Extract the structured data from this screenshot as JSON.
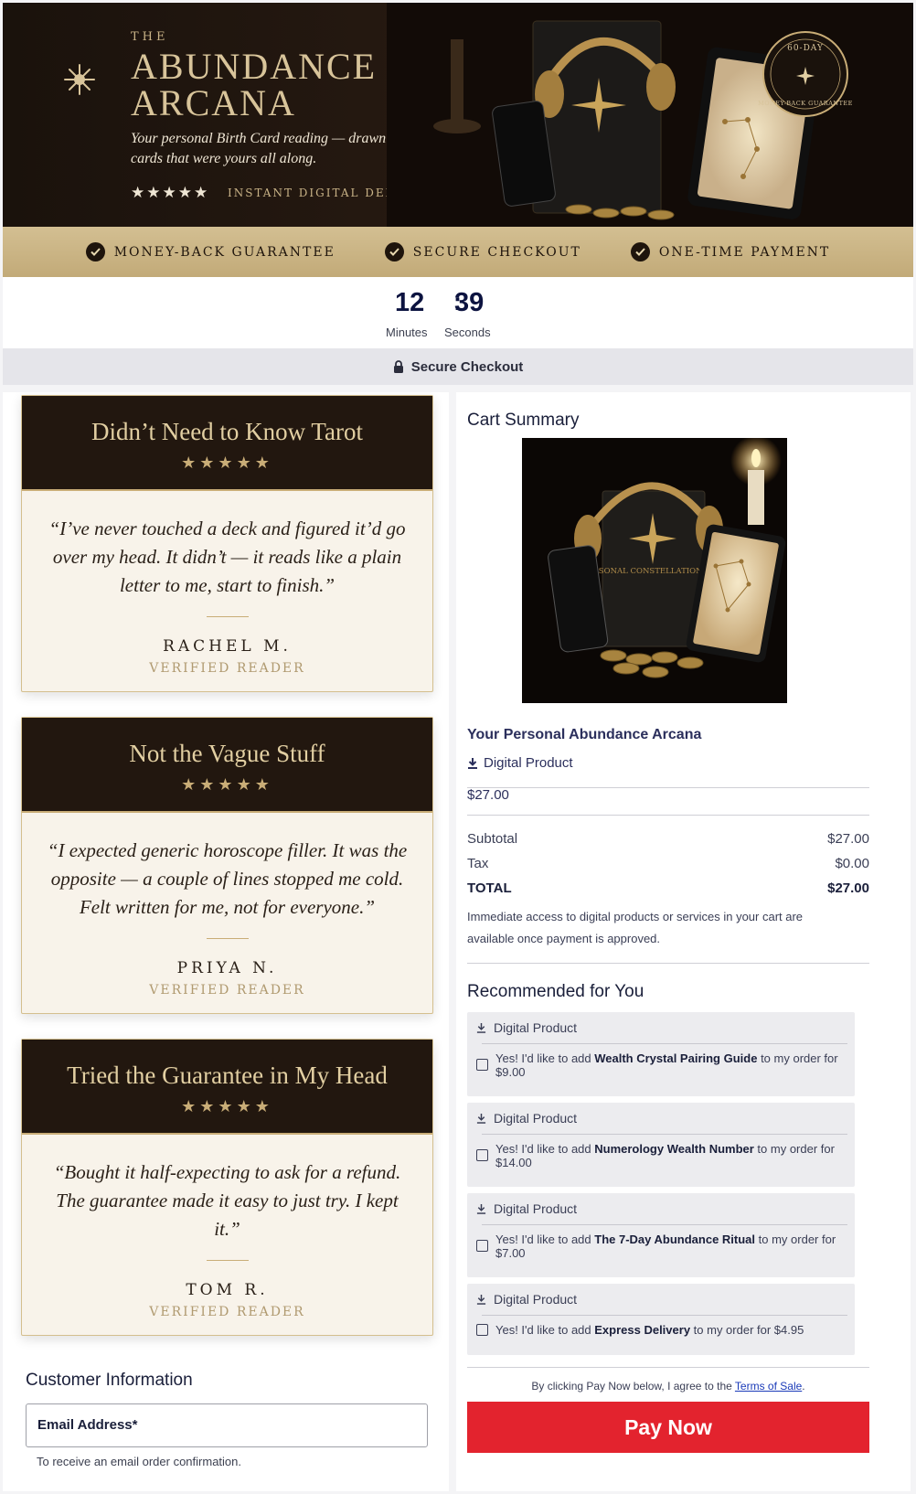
{
  "hero": {
    "the": "THE",
    "title_line1": "ABUNDANCE",
    "title_line2": "ARCANA",
    "subtitle": "Your personal Birth Card reading — drawn from the cards that were yours all along.",
    "stars": "★★★★★",
    "delivery": "INSTANT DIGITAL DELIVERY",
    "badge_top": "60-DAY",
    "badge_bottom": "MONEY-BACK GUARANTEE"
  },
  "trust_bar": {
    "items": [
      "MONEY-BACK GUARANTEE",
      "SECURE CHECKOUT",
      "ONE-TIME PAYMENT"
    ]
  },
  "timer": {
    "minutes": "12",
    "seconds": "39",
    "separator": ":",
    "minutes_label": "Minutes",
    "seconds_label": "Seconds"
  },
  "secure_checkout": "Secure Checkout",
  "testimonials": [
    {
      "title": "Didn’t Need to Know Tarot",
      "stars": "★★★★★",
      "quote": "“I’ve never touched a deck and figured it’d go over my head. It didn’t — it reads like a plain letter to me, start to finish.”",
      "author": "RACHEL M.",
      "role": "VERIFIED READER"
    },
    {
      "title": "Not the Vague Stuff",
      "stars": "★★★★★",
      "quote": "“I expected generic horoscope filler. It was the opposite — a couple of lines stopped me cold. Felt written for me, not for everyone.”",
      "author": "PRIYA N.",
      "role": "VERIFIED READER"
    },
    {
      "title": "Tried the Guarantee in My Head",
      "stars": "★★★★★",
      "quote": "“Bought it half-expecting to ask for a refund. The guarantee made it easy to just try. I kept it.”",
      "author": "TOM R.",
      "role": "VERIFIED READER"
    }
  ],
  "customer": {
    "title": "Customer Information",
    "email_label": "Email Address*",
    "email_hint": "To receive an email order confirmation."
  },
  "cart": {
    "title": "Cart Summary",
    "book_text": "YOUR PERSONAL CONSTELLATION READING",
    "product_name": "Your Personal Abundance Arcana",
    "product_type": "Digital Product",
    "product_price": "$27.00",
    "subtotal_label": "Subtotal",
    "subtotal": "$27.00",
    "tax_label": "Tax",
    "tax": "$0.00",
    "total_label": "TOTAL",
    "total": "$27.00",
    "notice": "Immediate access to digital products or services in your cart are available once payment is approved."
  },
  "recommended": {
    "title": "Recommended for You",
    "items": [
      {
        "type": "Digital Product",
        "prefix": "Yes! I'd like to add ",
        "name": "Wealth Crystal Pairing Guide",
        "suffix": " to my order for $9.00"
      },
      {
        "type": "Digital Product",
        "prefix": "Yes! I'd like to add ",
        "name": "Numerology Wealth Number",
        "suffix": " to my order for $14.00"
      },
      {
        "type": "Digital Product",
        "prefix": "Yes! I'd like to add ",
        "name": "The 7-Day Abundance Ritual",
        "suffix": " to my order for $7.00"
      },
      {
        "type": "Digital Product",
        "prefix": "Yes! I'd like to add ",
        "name": "Express Delivery",
        "suffix": " to my order for $4.95"
      }
    ]
  },
  "agree": {
    "text": "By clicking Pay Now below, I agree to the ",
    "link": "Terms of Sale",
    "end": "."
  },
  "pay_button": "Pay Now",
  "colors": {
    "gold": "#c9ad77",
    "dark_brown": "#22170f",
    "pay_red": "#e3232e",
    "navy": "#0c1340"
  }
}
